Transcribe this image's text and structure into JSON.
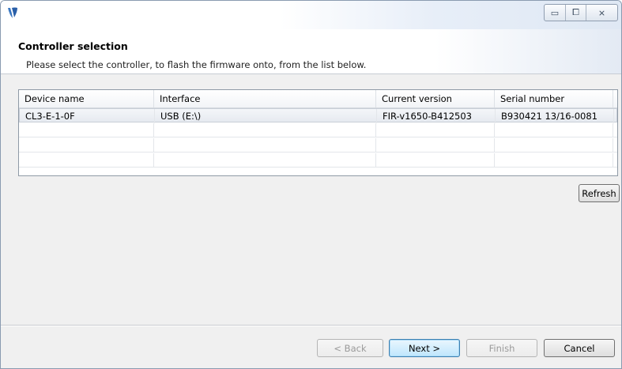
{
  "titlebar": {
    "icon": "app-logo-icon",
    "controls": {
      "minimize": "▭",
      "maximize": "⧠",
      "close": "⨯"
    }
  },
  "header": {
    "title": "Controller selection",
    "subtitle": "Please select the controller, to flash the firmware onto, from the list below."
  },
  "table": {
    "columns": [
      "Device name",
      "Interface",
      "Current version",
      "Serial number"
    ],
    "rows": [
      {
        "device_name": "CL3-E-1-0F",
        "interface": "USB (E:\\)",
        "current_version": "FIR-v1650-B412503",
        "serial_number": "B930421 13/16-0081",
        "selected": true
      }
    ]
  },
  "refresh_label": "Refresh",
  "buttons": {
    "back": "< Back",
    "next": "Next >",
    "finish": "Finish",
    "cancel": "Cancel"
  }
}
